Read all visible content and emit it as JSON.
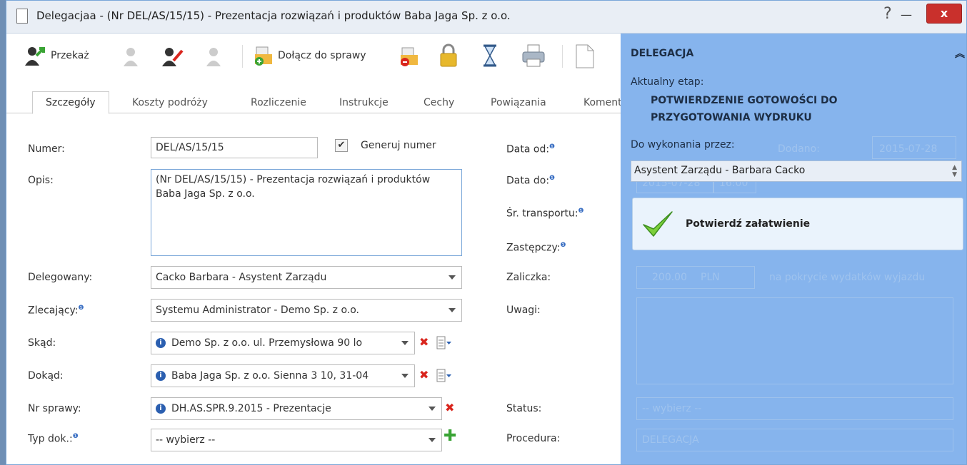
{
  "window": {
    "title": "Delegacjaa - (Nr DEL/AS/15/15) - Prezentacja rozwiązań i produktów Baba Jaga Sp. z o.o.",
    "help": "?",
    "minimize": "—",
    "close": "x"
  },
  "toolbar": {
    "forward_label": "Przekaż",
    "attach_label": "Dołącz do sprawy"
  },
  "tabs": [
    "Szczegóły",
    "Koszty podróży",
    "Rozliczenie",
    "Instrukcje",
    "Cechy",
    "Powiązania",
    "Komentarze"
  ],
  "form": {
    "numer_label": "Numer:",
    "numer_value": "DEL/AS/15/15",
    "generate_label": "Generuj numer",
    "opis_label": "Opis:",
    "opis_value": "(Nr DEL/AS/15/15) - Prezentacja rozwiązań i produktów Baba Jaga Sp. z o.o.",
    "delegowany_label": "Delegowany:",
    "delegowany_value": "Cacko Barbara - Asystent Zarządu",
    "zlecajacy_label": "Zlecający:",
    "zlecajacy_value": "Systemu Administrator - Demo Sp. z o.o.",
    "skad_label": "Skąd:",
    "skad_value": "Demo Sp. z o.o. ul. Przemysłowa 90 lo",
    "dokad_label": "Dokąd:",
    "dokad_value": "Baba Jaga Sp. z o.o. Sienna 3 10, 31-04",
    "nr_sprawy_label": "Nr sprawy:",
    "nr_sprawy_value": "DH.AS.SPR.9.2015 - Prezentacje",
    "typ_label": "Typ dok.:",
    "typ_value": "-- wybierz --",
    "data_od_label": "Data od:",
    "data_do_label": "Data do:",
    "transport_label": "Śr. transportu:",
    "zastepczy_label": "Zastępczy:",
    "zaliczka_label": "Zaliczka:",
    "uwagi_label": "Uwagi:",
    "status_label": "Status:",
    "procedura_label": "Procedura:",
    "info_sup": "❶"
  },
  "background": {
    "dodano_label": "Dodano:",
    "dodano_value": "2015-07-28",
    "date_value": "2015-07-28",
    "time_value": "16:00",
    "zaliczka_amount": "200.00",
    "zaliczka_currency": "PLN",
    "zaliczka_note": "na pokrycie wydatków wyjazdu",
    "status_value": "-- wybierz --",
    "procedura_value": "DELEGACJA"
  },
  "panel": {
    "title": "DELEGACJA",
    "stage_label": "Aktualny etap:",
    "stage_value": "POTWIERDZENIE GOTOWOŚCI DO PRZYGOTOWANIA WYDRUKU",
    "exec_label": "Do wykonania przez:",
    "exec_value": "Asystent Zarządu - Barbara Cacko",
    "confirm_label": "Potwierdź załatwienie"
  },
  "colors": {
    "panel_bg": "#86b4ed",
    "close_btn": "#c9302c",
    "confirm_bg": "#eaf3fc"
  }
}
